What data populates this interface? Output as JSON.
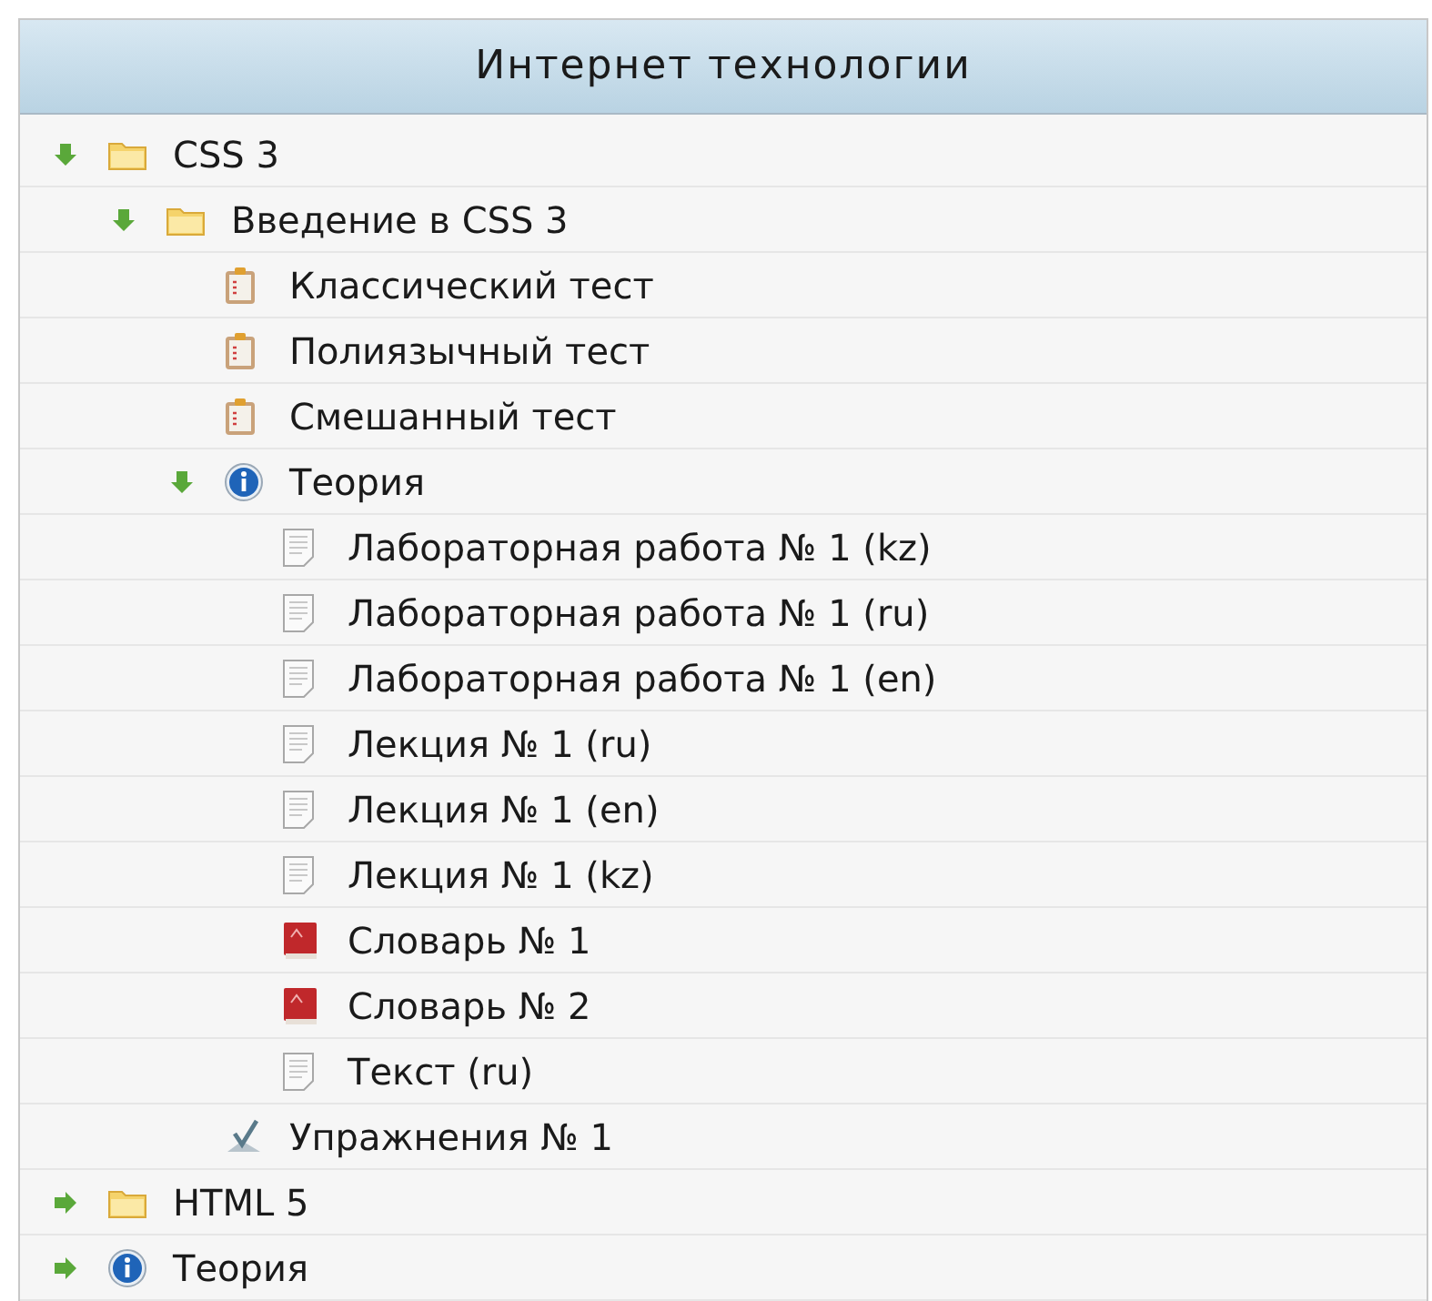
{
  "panel": {
    "title": "Интернет технологии"
  },
  "tree": [
    {
      "kind": "folder",
      "label": "CSS 3",
      "expanded": true,
      "children": [
        {
          "kind": "folder",
          "label": "Введение в CSS 3",
          "expanded": true,
          "children": [
            {
              "kind": "test",
              "label": "Классический тест"
            },
            {
              "kind": "test",
              "label": "Полиязычный тест"
            },
            {
              "kind": "test",
              "label": "Смешанный тест"
            },
            {
              "kind": "info",
              "label": "Теория",
              "expanded": true,
              "children": [
                {
                  "kind": "document",
                  "label": "Лабораторная работа № 1 (kz)"
                },
                {
                  "kind": "document",
                  "label": "Лабораторная работа № 1 (ru)"
                },
                {
                  "kind": "document",
                  "label": "Лабораторная работа № 1 (en)"
                },
                {
                  "kind": "document",
                  "label": "Лекция № 1 (ru)"
                },
                {
                  "kind": "document",
                  "label": "Лекция № 1 (en)"
                },
                {
                  "kind": "document",
                  "label": "Лекция № 1 (kz)"
                },
                {
                  "kind": "dictionary",
                  "label": "Словарь № 1"
                },
                {
                  "kind": "dictionary",
                  "label": "Словарь № 2"
                },
                {
                  "kind": "document",
                  "label": "Текст (ru)"
                }
              ]
            },
            {
              "kind": "exercise",
              "label": "Упражнения № 1"
            }
          ]
        }
      ]
    },
    {
      "kind": "folder",
      "label": "HTML 5",
      "expanded": false
    },
    {
      "kind": "info",
      "label": "Теория",
      "expanded": false
    }
  ]
}
